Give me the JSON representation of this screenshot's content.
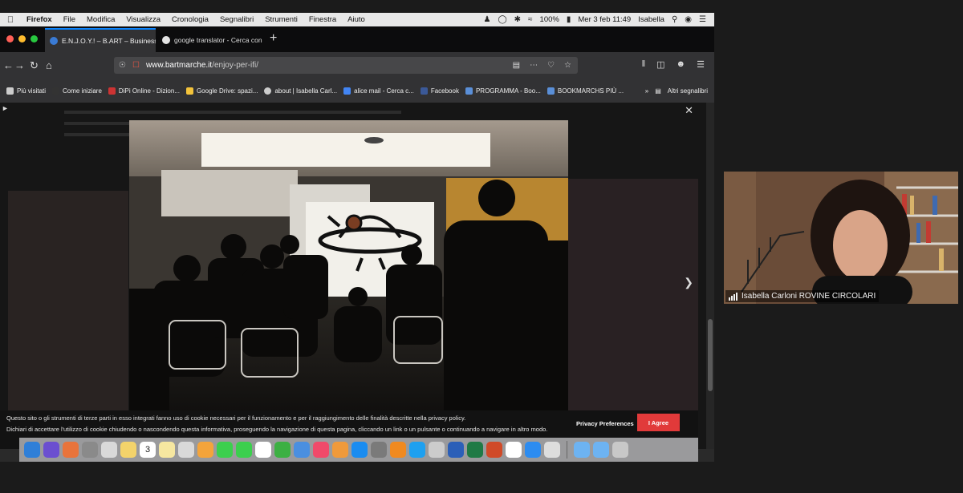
{
  "menubar": {
    "app": "Firefox",
    "items": [
      "File",
      "Modifica",
      "Visualizza",
      "Cronologia",
      "Segnalibri",
      "Strumenti",
      "Finestra",
      "Aiuto"
    ],
    "battery": "100%",
    "datetime": "Mer 3 feb 11:49",
    "user": "Isabella"
  },
  "tabs": [
    {
      "title": "E.N.J.O.Y.! – B.ART – Business",
      "active": true,
      "favicon_color": "#3a7bd5"
    },
    {
      "title": "google translator - Cerca con",
      "active": false,
      "favicon_color": "#e4e4e4"
    }
  ],
  "urlbar": {
    "domain": "www.bartmarche.it",
    "path": "/enjoy-per-ifi/"
  },
  "bookmarks": [
    {
      "label": "Più visitati",
      "color": "#cccccc"
    },
    {
      "label": "Come iniziare",
      "color": "#333333"
    },
    {
      "label": "DiPi Online - Dizion...",
      "color": "#cc3333"
    },
    {
      "label": "Google Drive: spazi...",
      "color": "#f3c33b"
    },
    {
      "label": "about | Isabella Carl...",
      "color": "#cccccc"
    },
    {
      "label": "alice mail - Cerca c...",
      "color": "#4285f4"
    },
    {
      "label": "Facebook",
      "color": "#3b5998"
    },
    {
      "label": "PROGRAMMA - Boo...",
      "color": "#5a8fd8"
    },
    {
      "label": "BOOKMARCHS PIÙ ...",
      "color": "#5a8fd8"
    }
  ],
  "bookmarks_more": "Altri segnalibri",
  "cookie": {
    "line1": "Questo sito o gli strumenti di terze parti in esso integrati fanno uso di cookie necessari per il funzionamento e per il raggiungimento delle finalità descritte nella privacy policy.",
    "line2": "Dichiari di accettare l'utilizzo di cookie chiudendo o nascondendo questa informativa, proseguendo la navigazione di questa pagina, cliccando un link o un pulsante o continuando a navigare in altro modo.",
    "privacy_label": "Privacy Preferences",
    "agree_label": "I Agree"
  },
  "dock_icons": [
    "finder",
    "siri",
    "firefox",
    "launchpad",
    "preview",
    "notes",
    "calendar",
    "stickies",
    "photos-app",
    "photos",
    "messages",
    "facetime",
    "reminders",
    "numbers",
    "keynote",
    "music",
    "books",
    "app-store",
    "system-preferences",
    "vlc",
    "skype",
    "utility",
    "word",
    "excel",
    "powerpoint",
    "textedit",
    "zoom",
    "misc",
    "folder",
    "downloads",
    "trash"
  ],
  "dock_colors": [
    "#2f7fd8",
    "#6b4fd0",
    "#e8743b",
    "#8a8a8a",
    "#d9d9d9",
    "#f3d36b",
    "#ffffff",
    "#f6e7a0",
    "#d9d9d9",
    "#f4a43b",
    "#3ccf4e",
    "#3ccf4e",
    "#ffffff",
    "#3cb043",
    "#4a8fe0",
    "#f04a6a",
    "#f09a3b",
    "#1a8cf0",
    "#7a7a7a",
    "#f08a20",
    "#1ea0f0",
    "#cccccc",
    "#2b5fb8",
    "#1f7a45",
    "#d04a28",
    "#ffffff",
    "#2d8cf0",
    "#ddd",
    "#6db3f2",
    "#6db3f2",
    "#c8c8c8"
  ],
  "calendar_day": "3",
  "participant": {
    "name": "Isabella Carloni ROVINE CIRCOLARI"
  }
}
